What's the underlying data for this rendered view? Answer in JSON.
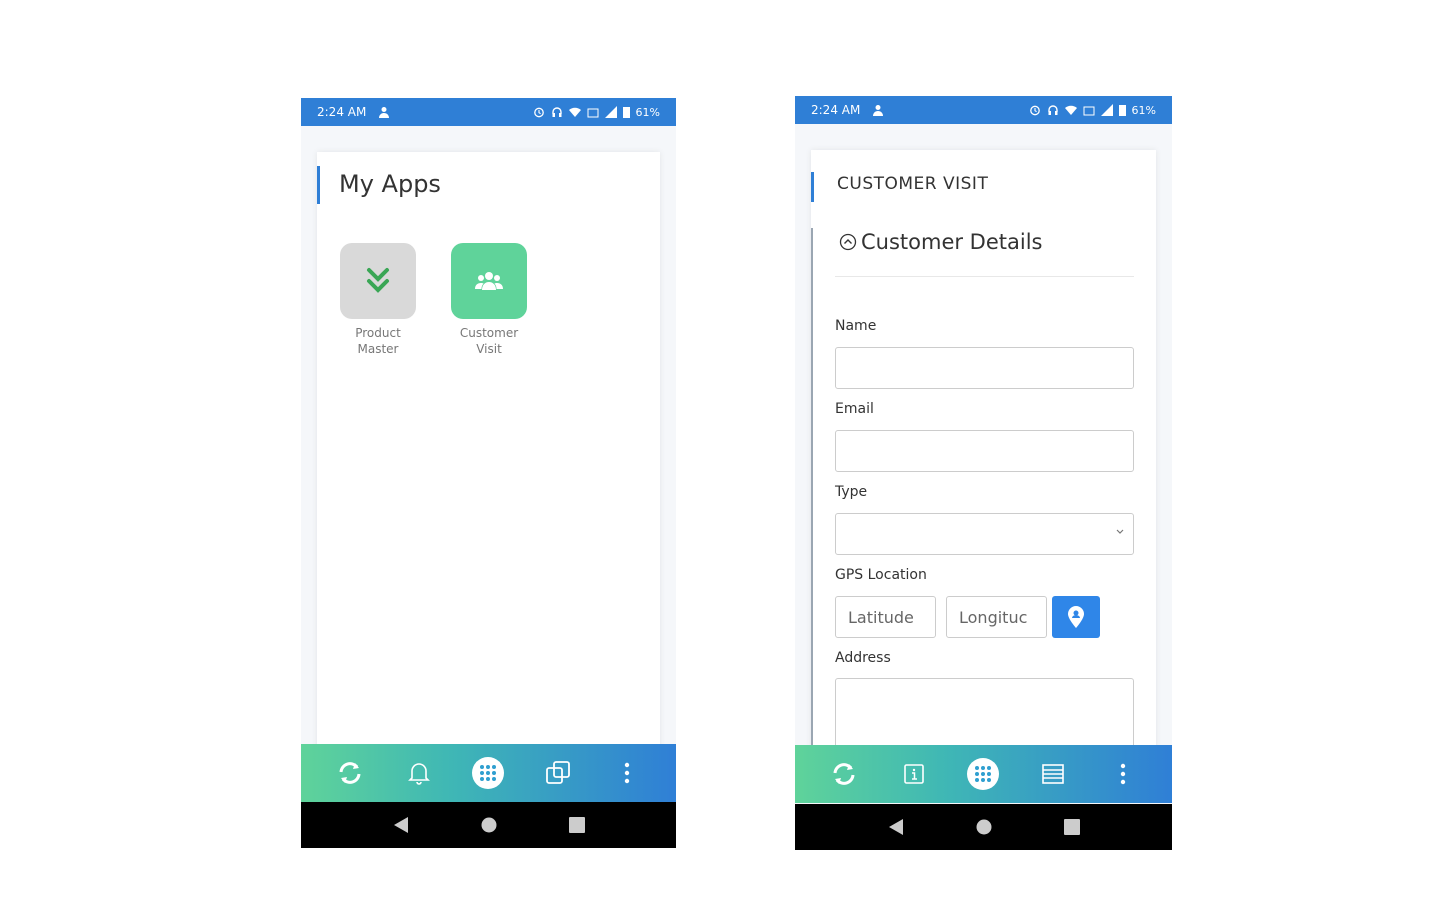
{
  "status_bar": {
    "time": "2:24 AM",
    "battery": "61%"
  },
  "colors": {
    "primary": "#2f7fd6",
    "tile_gray": "#d9d9d9",
    "tile_green": "#5fd39a",
    "chevron_green": "#3aa655"
  },
  "my_apps": {
    "title": "My Apps",
    "apps": [
      {
        "line1": "Product",
        "line2": "Master",
        "icon": "double-chevron-down-icon"
      },
      {
        "line1": "Customer",
        "line2": "Visit",
        "icon": "users-icon"
      }
    ]
  },
  "nav_left": {
    "icons": [
      "sync-icon",
      "bell-icon",
      "apps-grid-icon",
      "copy-icon",
      "more-vertical-icon"
    ]
  },
  "nav_right": {
    "icons": [
      "sync-icon",
      "info-icon",
      "apps-grid-icon",
      "list-icon",
      "more-vertical-icon"
    ]
  },
  "customer_visit": {
    "title": "CUSTOMER VISIT",
    "section": "Customer Details",
    "fields": {
      "name_label": "Name",
      "email_label": "Email",
      "type_label": "Type",
      "gps_label": "GPS Location",
      "latitude_placeholder": "Latitude",
      "longitude_placeholder": "Longituc",
      "address_label": "Address"
    }
  }
}
